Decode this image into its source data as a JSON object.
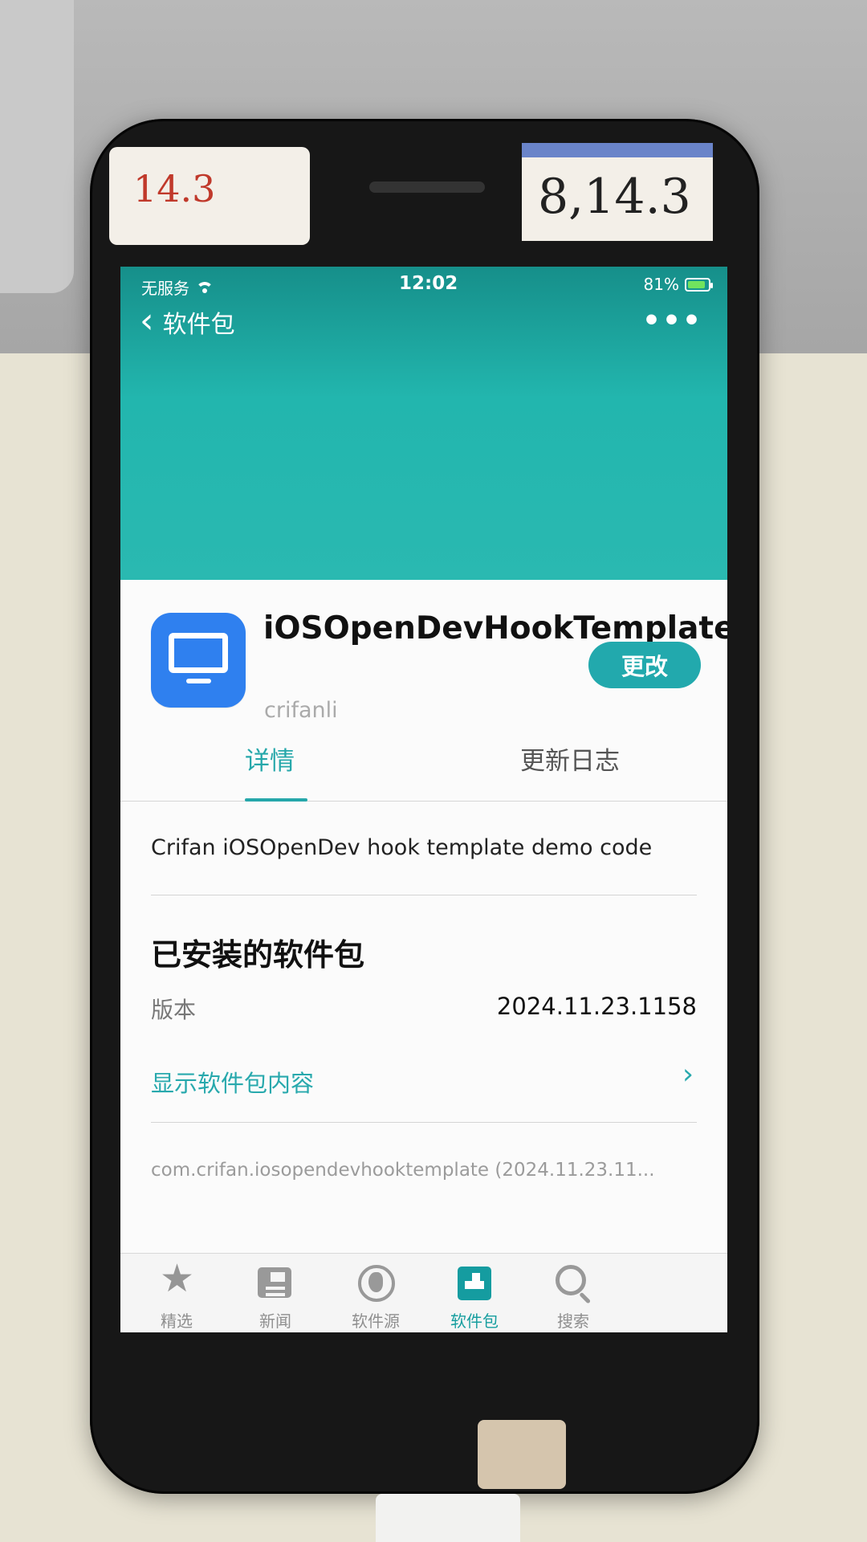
{
  "environment": {
    "sticker_left_text": "14.3",
    "sticker_right_text": "8,14.3"
  },
  "status_bar": {
    "carrier": "无服务",
    "time": "12:02",
    "battery": "81%"
  },
  "nav": {
    "back_label": "软件包",
    "more_label": "•••"
  },
  "app": {
    "title": "iOSOpenDevHookTemplate",
    "developer": "crifanli",
    "update_button": "更改",
    "icon_name": "monitor-icon"
  },
  "tabs": {
    "details": "详情",
    "changelog": "更新日志"
  },
  "details": {
    "description": "Crifan iOSOpenDev hook template demo code",
    "installed_section_title": "已安装的软件包",
    "version_label": "版本",
    "version_value": "2024.11.23.1158",
    "show_contents_label": "显示软件包内容",
    "package_id": "com.crifan.iosopendevhooktemplate (2024.11.23.11..."
  },
  "tabbar": {
    "items": [
      {
        "label": "精选",
        "icon": "star-icon",
        "active": false
      },
      {
        "label": "新闻",
        "icon": "news-icon",
        "active": false
      },
      {
        "label": "软件源",
        "icon": "globe-icon",
        "active": false
      },
      {
        "label": "软件包",
        "icon": "package-icon",
        "active": true
      },
      {
        "label": "搜索",
        "icon": "search-icon",
        "active": false
      }
    ]
  },
  "colors": {
    "accent": "#25a7aa",
    "header_teal": "#22b6ae",
    "app_icon_blue": "#2f80ef"
  }
}
